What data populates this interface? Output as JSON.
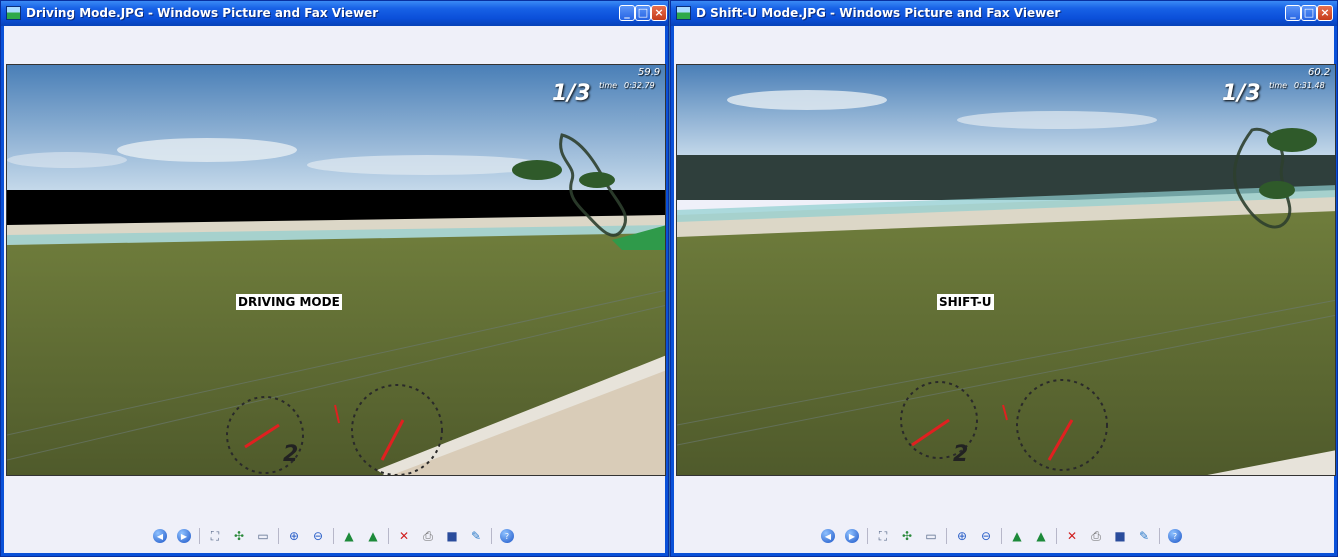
{
  "windows": [
    {
      "id": "left",
      "title": "Driving Mode.JPG - Windows Picture and Fax Viewer",
      "overlay_label": "DRIVING MODE",
      "hud": {
        "lap": "1/3",
        "time_word": "time",
        "time_value": "0:32.79",
        "fps": "59.9",
        "gear": "2"
      }
    },
    {
      "id": "right",
      "title": "D Shift-U Mode.JPG - Windows Picture and Fax Viewer",
      "overlay_label": "SHIFT-U",
      "hud": {
        "lap": "1/3",
        "time_word": "time",
        "time_value": "0:31.48",
        "fps": "60.2",
        "gear": "2"
      }
    }
  ],
  "title_buttons": {
    "minimize": "_",
    "maximize": "□",
    "close": "×"
  },
  "toolbar_icons": [
    "previous-image-icon",
    "next-image-icon",
    "best-fit-icon",
    "actual-size-icon",
    "slideshow-icon",
    "zoom-in-icon",
    "zoom-out-icon",
    "rotate-clockwise-icon",
    "rotate-counterclockwise-icon",
    "delete-icon",
    "print-icon",
    "save-icon",
    "edit-icon",
    "help-icon"
  ],
  "colors": {
    "title_bar": "#0b4fd9",
    "client_bg": "#eff0f9",
    "close_button": "#c63c1a"
  }
}
